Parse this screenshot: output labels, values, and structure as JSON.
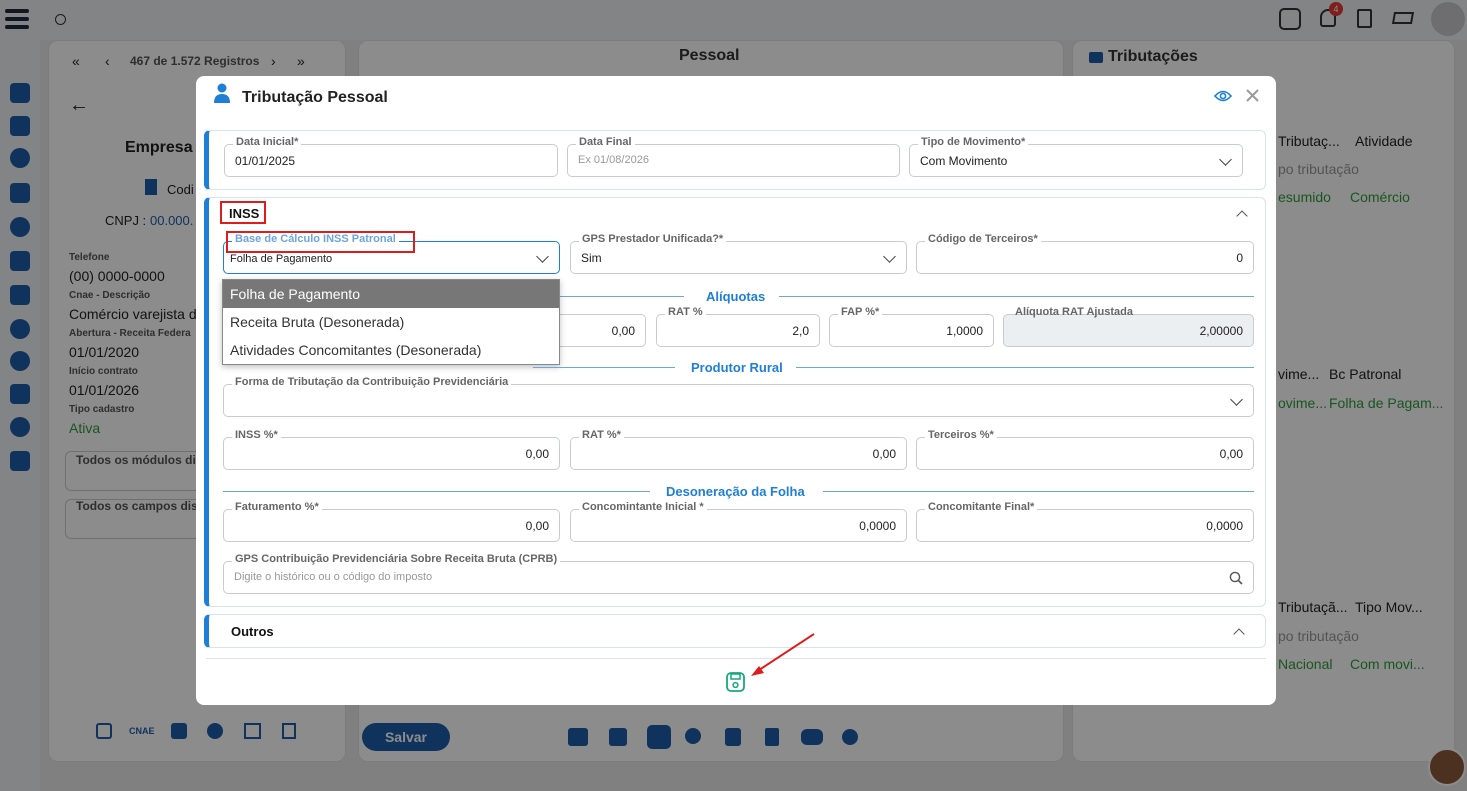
{
  "background": {
    "records": "467 de 1.572 Registros",
    "left_panel": {
      "company_title": "Empresa",
      "code_label": "Codi",
      "cnpj_label": "CNPJ :",
      "cnpj_value": "00.000.",
      "phone_label": "Telefone",
      "phone_value": "(00) 0000-0000",
      "cnae_label": "Cnae - Descrição",
      "cnae_value": "Comércio varejista d",
      "opening_label": "Abertura - Receita Federa",
      "opening_value": "01/01/2020",
      "contract_label": "Início contrato",
      "contract_value": "01/01/2026",
      "type_label": "Tipo cadastro",
      "type_value": "Ativa",
      "modules_label": "Todos os módulos dis",
      "fields_label": "Todos os campos dis",
      "cnae_tool": "CNAE"
    },
    "middle_panel": {
      "title": "Pessoal",
      "save_button": "Salvar"
    },
    "right_panel": {
      "title": "Tributações",
      "card1": {
        "col1": "Tributaç...",
        "col2": "Atividade",
        "sub": "po tributação",
        "cell1": "esumido",
        "cell2": "Comércio"
      },
      "card2": {
        "col1": "vime...",
        "col2": "Bc Patronal",
        "cell1": "ovime...",
        "cell2": "Folha de Pagam..."
      },
      "card3": {
        "col1": "Tributaçã...",
        "col2": "Tipo Mov...",
        "sub": "po tributação",
        "cell1": "Nacional",
        "cell2": "Com movi..."
      }
    },
    "notification_count": "4"
  },
  "modal": {
    "title": "Tributação Pessoal",
    "header": {
      "data_inicial": {
        "label": "Data Inicial*",
        "value": "01/01/2025"
      },
      "data_final": {
        "label": "Data Final",
        "placeholder": "Ex 01/08/2026"
      },
      "tipo_movimento": {
        "label": "Tipo de Movimento*",
        "value": "Com Movimento"
      }
    },
    "inss": {
      "title": "INSS",
      "base_calculo": {
        "label": "Base de Cálculo INSS Patronal",
        "value": "Folha de Pagamento"
      },
      "gps_prestador": {
        "label": "GPS Prestador Unificada?*",
        "value": "Sim"
      },
      "codigo_terceiros": {
        "label": "Código de Terceiros*",
        "value": "0"
      },
      "dropdown_options": [
        "Folha de Pagamento",
        "Receita Bruta (Desonerada)",
        "Atividades Concomitantes (Desonerada)"
      ],
      "aliquotas": {
        "title": "Alíquotas",
        "inss_value": "0,00",
        "rat": {
          "label": "RAT %",
          "value": "2,0"
        },
        "fap": {
          "label": "FAP %*",
          "value": "1,0000"
        },
        "rat_ajustada": {
          "label": "Alíquota RAT Ajustada",
          "value": "2,00000"
        }
      },
      "produtor_rural": {
        "title": "Produtor Rural",
        "forma_tributacao": {
          "label": "Forma de Tributação da Contribuição Previdenciária"
        },
        "inss": {
          "label": "INSS %*",
          "value": "0,00"
        },
        "rat": {
          "label": "RAT %*",
          "value": "0,00"
        },
        "terceiros": {
          "label": "Terceiros %*",
          "value": "0,00"
        }
      },
      "desoneracao": {
        "title": "Desoneração da Folha",
        "faturamento": {
          "label": "Faturamento %*",
          "value": "0,00"
        },
        "concomitante_inicial": {
          "label": "Concomintante Inicial *",
          "value": "0,0000"
        },
        "concomitante_final": {
          "label": "Concomitante Final*",
          "value": "0,0000"
        }
      },
      "gps_cprb": {
        "label": "GPS Contribuição Previdenciária Sobre Receita Bruta (CPRB)",
        "placeholder": "Digite o histórico ou o código do imposto"
      }
    },
    "outros": {
      "title": "Outros"
    }
  },
  "colors": {
    "accent": "#1d7fd6",
    "highlight": "#e01b1b",
    "save": "#17a87b",
    "active_green": "#2e9d3a"
  }
}
